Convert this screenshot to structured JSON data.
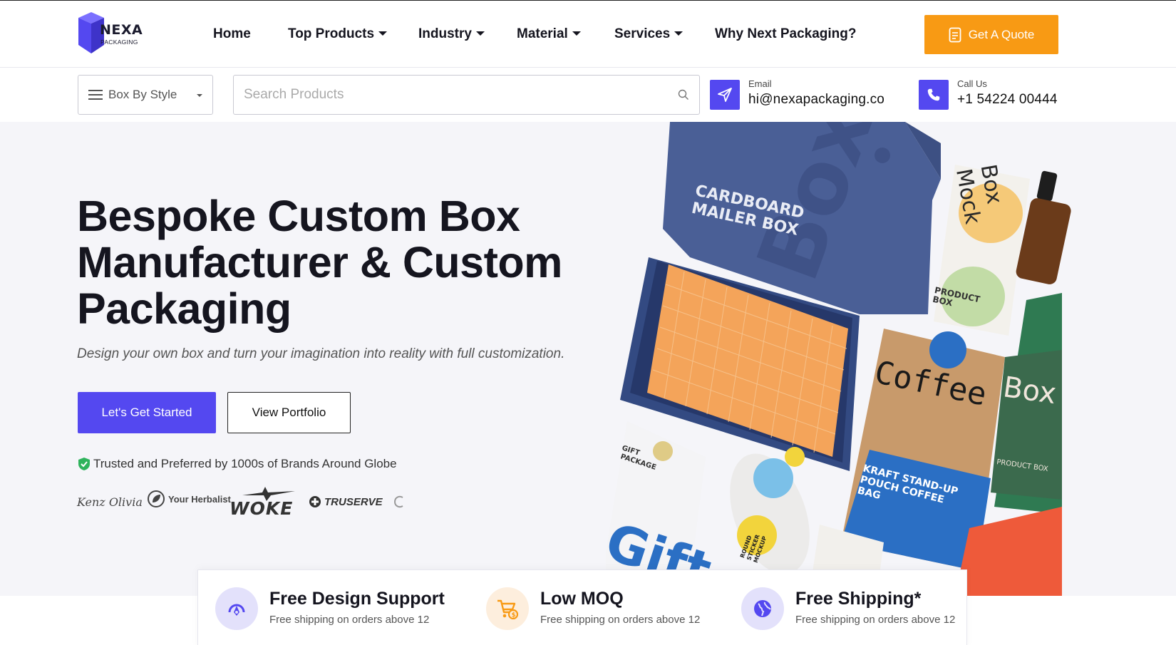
{
  "brand": {
    "name": "NEXA",
    "tagline": "PACKAGING"
  },
  "nav": {
    "items": [
      {
        "label": "Home",
        "has_dropdown": false
      },
      {
        "label": "Top Products",
        "has_dropdown": true
      },
      {
        "label": "Industry",
        "has_dropdown": true
      },
      {
        "label": "Material",
        "has_dropdown": true
      },
      {
        "label": "Services",
        "has_dropdown": true
      },
      {
        "label": "Why Next Packaging?",
        "has_dropdown": false
      }
    ],
    "cta_label": "Get A Quote"
  },
  "subbar": {
    "category_select": "Box By Style",
    "search_placeholder": "Search Products",
    "email": {
      "label": "Email",
      "value": "hi@nexapackaging.co"
    },
    "phone": {
      "label": "Call Us",
      "value": "+1 54224 00444"
    }
  },
  "hero": {
    "title": "Bespoke Custom Box Manufacturer & Custom Packaging",
    "subtitle": "Design your own box and turn your imagination into reality with full customization.",
    "primary_button": "Let's Get Started",
    "secondary_button": "View Portfolio",
    "trust_text": "Trusted and Preferred by 1000s of Brands Around Globe",
    "brand_logos": [
      "Kenz Olivia",
      "Your Herbalist",
      "WOKE",
      "TRUSERVE"
    ]
  },
  "product_image_text": {
    "mailer": "CARDBOARD MAILER BOX",
    "box_word": "Box",
    "mock": "Box Mock",
    "product_box": "PRODUCT BOX",
    "coffee": "Coffee",
    "kraft": "KRAFT STAND-UP POUCH COFFEE BAG",
    "box2": "Box",
    "product_box2": "PRODUCT BOX",
    "gift": "GIFT PACKAGE",
    "gift_big": "Gift",
    "sticker": "ROUND STICKER MOCKUP"
  },
  "features": [
    {
      "title": "Free Design Support",
      "subtitle": "Free shipping on orders above 12",
      "icon": "design-support-icon"
    },
    {
      "title": "Low MOQ",
      "subtitle": "Free shipping on orders above 12",
      "icon": "cart-icon"
    },
    {
      "title": "Free Shipping*",
      "subtitle": "Free shipping on orders above 12",
      "icon": "globe-icon"
    }
  ],
  "colors": {
    "accent": "#5448f0",
    "cta": "#f89a14",
    "hero_bg": "#f5f5f9",
    "trust_green": "#2fb35c"
  }
}
